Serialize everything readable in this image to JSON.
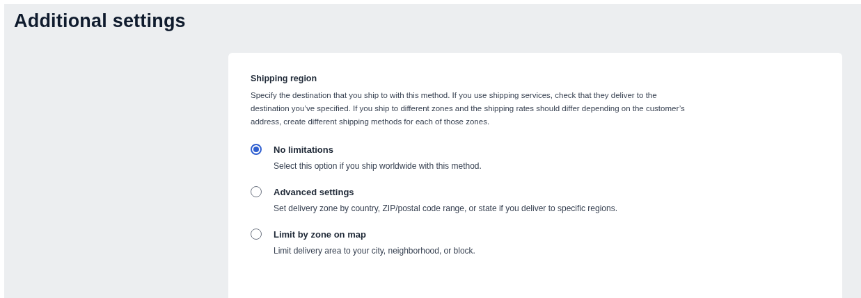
{
  "title": "Additional settings",
  "section": {
    "heading": "Shipping region",
    "description": "Specify the destination that you ship to with this method. If you use shipping services, check that they deliver to the destination you’ve specified. If you ship to different zones and the shipping rates should differ depending on the customer’s address, create different shipping methods for each of those zones.",
    "options": [
      {
        "label": "No limitations",
        "hint": "Select this option if you ship worldwide with this method.",
        "selected": true
      },
      {
        "label": "Advanced settings",
        "hint": "Set delivery zone by country, ZIP/postal code range, or state if you deliver to specific regions.",
        "selected": false
      },
      {
        "label": "Limit by zone on map",
        "hint": "Limit delivery area to your city, neighborhood, or block.",
        "selected": false
      }
    ]
  }
}
